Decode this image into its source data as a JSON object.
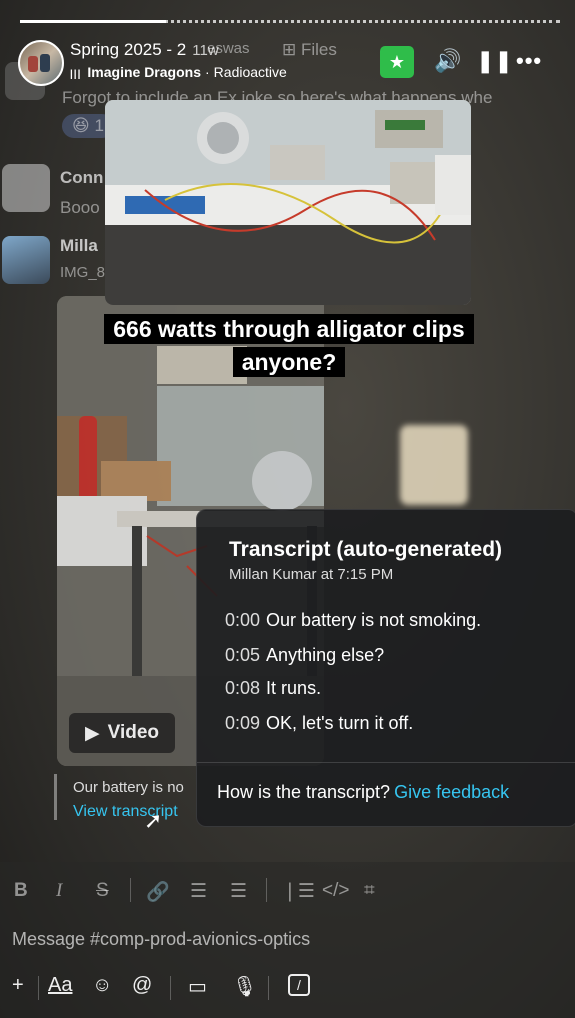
{
  "story": {
    "progress": 0.27
  },
  "header": {
    "title": "Spring 2025 - 2",
    "ago": "11w",
    "music_artist": "Imagine Dragons",
    "music_separator": "·",
    "music_track": "Radioactive"
  },
  "background_chat": {
    "tab_files": "Files",
    "lanes": "eswas",
    "msg_partial": "Forgot to include an Ex joke so here's what happens whe",
    "reaction_count": "1",
    "user2_name": "Conn",
    "user2_msg": "Booo",
    "user3_name": "Milla",
    "user3_file": "IMG_8"
  },
  "caption": {
    "line1": "666 watts through alligator clips",
    "line2": "anyone?"
  },
  "video_badge": "Video",
  "transcript": {
    "title": "Transcript (auto-generated)",
    "byline": "Millan Kumar at 7:15 PM",
    "lines": [
      {
        "time": "0:00",
        "text": "Our battery is not smoking."
      },
      {
        "time": "0:05",
        "text": "Anything else?"
      },
      {
        "time": "0:08",
        "text": "It runs."
      },
      {
        "time": "0:09",
        "text": "OK, let's turn it off."
      }
    ],
    "feedback_question": "How is the transcript?",
    "feedback_link": "Give feedback"
  },
  "message_under": {
    "preview": "Our battery is no",
    "view_link": "View transcript"
  },
  "composer": {
    "placeholder": "Message #comp-prod-avionics-optics",
    "format_icons": [
      "bold-icon",
      "italic-icon",
      "strikethrough-icon",
      "link-icon",
      "ordered-list-icon",
      "bullet-list-icon",
      "blockquote-icon",
      "code-icon",
      "code-block-icon"
    ],
    "bottom_icons": [
      "plus-icon",
      "text-format-icon",
      "emoji-icon",
      "mention-icon",
      "video-icon",
      "microphone-icon",
      "slash-command-icon"
    ]
  },
  "colors": {
    "accent_green": "#2fbd4a",
    "link_blue": "#36c5f0"
  }
}
